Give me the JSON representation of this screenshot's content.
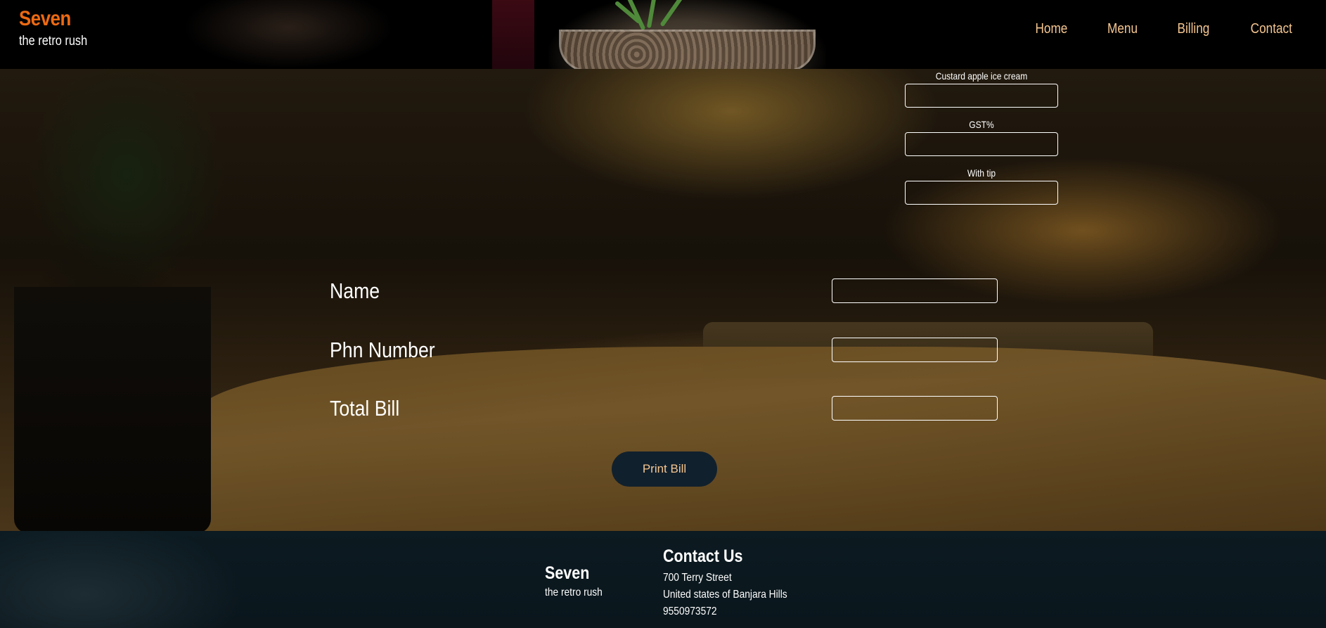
{
  "header": {
    "brand_name": "Seven",
    "brand_tagline": "the retro rush",
    "nav": [
      "Home",
      "Menu",
      "Billing",
      "Contact"
    ]
  },
  "items": [
    {
      "label": "Custard apple ice cream",
      "value": ""
    },
    {
      "label": "GST%",
      "value": ""
    },
    {
      "label": "With tip",
      "value": ""
    }
  ],
  "customer": {
    "name_label": "Name",
    "phone_label": "Phn Number",
    "total_label": "Total Bill",
    "name_value": "",
    "phone_value": "",
    "total_value": ""
  },
  "print_button": "Print Bill",
  "footer": {
    "brand_name": "Seven",
    "brand_tagline": "the retro rush",
    "contact_title": "Contact Us",
    "address_line1": "700 Terry Street",
    "address_line2": "United states of Banjara Hills",
    "phone": "9550973572"
  },
  "colors": {
    "brand_orange": "#ec6a12",
    "nav_text": "#f5c690",
    "button_bg": "#11202d",
    "footer_bg": "#0c1a21"
  }
}
